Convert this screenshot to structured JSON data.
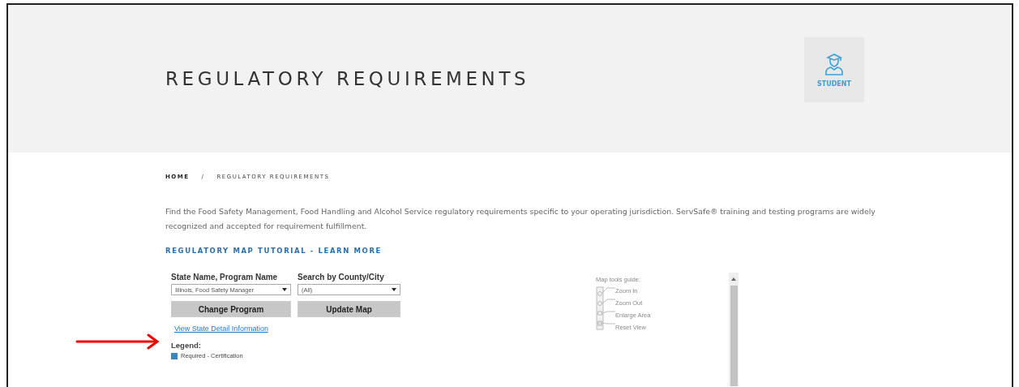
{
  "header": {
    "title": "REGULATORY REQUIREMENTS",
    "badge": {
      "label": "STUDENT"
    }
  },
  "breadcrumb": [
    "HOME",
    "/",
    "REGULATORY REQUIREMENTS"
  ],
  "intro": "Find the Food Safety Management, Food Handling and Alcohol Service regulatory requirements specific to your operating jurisdiction. ServSafe® training and testing programs are widely recognized and accepted for requirement fulfillment.",
  "tutorial_link": "REGULATORY MAP TUTORIAL - LEARN MORE",
  "form": {
    "fields": [
      {
        "label": "State Name, Program Name",
        "value": "Illinois, Food Safety Manager"
      },
      {
        "label": "Search by County/City",
        "value": "(All)"
      }
    ],
    "buttons": [
      "Change Program",
      "Update Map"
    ],
    "detail_link": "View State Detail Information",
    "legend": {
      "title": "Legend:",
      "items": [
        {
          "label": "Required - Certification",
          "color": "#3a87c0"
        }
      ]
    }
  },
  "map_tools_guide": {
    "title": "Map tools guide:",
    "items": [
      "Zoom In",
      "Zoom Out",
      "Enlarge Area",
      "Reset View"
    ]
  }
}
